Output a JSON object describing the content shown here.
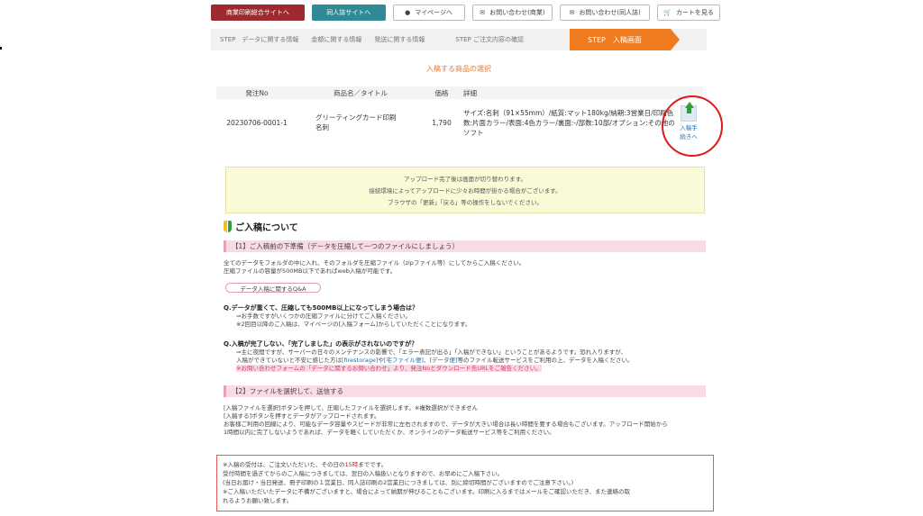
{
  "nav": {
    "btn1": "商業印刷総合サイトへ",
    "btn2": "同人誌サイトへ",
    "btn3": "マイページへ",
    "btn4": "お問い合わせ(商業)",
    "btn5": "お問い合わせ(同人誌)",
    "btn6": "カートを見る"
  },
  "steps": [
    "STEP　データに関する情報",
    "金額に関する情報",
    "発送に関する情報",
    "STEP ご注文内容の確認",
    "STEP　入稿画面"
  ],
  "select_title": "入稿する商品の選択",
  "table": {
    "headers": [
      "発注No",
      "商品名／タイトル",
      "価格",
      "詳細"
    ],
    "order_no": "20230706-0001-1",
    "name_line1": "グリーティングカード印刷",
    "name_line2": "名刺",
    "price": "1,790",
    "detail": "サイズ:名刺（91×55mm）/紙質:マット180kg/納期:3営業日/印刷色数:片面カラー/表面:4色カラー/裏面:-/部数:10部/オプション:その他のソフト"
  },
  "upload_label_1": "入稿手",
  "upload_label_2": "続きへ",
  "notice": {
    "line1": "アップロード完了後は画面が切り替わります。",
    "line2": "接続環境によってアップロードに少々お時間が掛かる場合がございます。",
    "line3": "ブラウザの「更新」「戻る」等の操作をしないでください。"
  },
  "about_title": "ご入稿について",
  "section1": {
    "heading": "【1】ご入稿前の下準備（データを圧縮して一つのファイルにしましょう）",
    "p1": "全てのデータをフォルダの中に入れ、そのフォルダを圧縮ファイル（zipファイル等）にしてからご入稿ください。",
    "p2": "圧縮ファイルの容量が500MB以下であればweb入稿が可能です。",
    "qa_button": "データ入稿に関するQ&A",
    "q1": "Q.データが重くて、圧縮しても500MB以上になってしまう場合は？",
    "a1_1": "⇒お手数ですがいくつかの圧縮ファイルに分けてご入稿ください。",
    "a1_2": "※2回目以降のご入稿は、マイページの[入稿フォーム]からしていただくことになります。",
    "q2": "Q.入稿が完了しない、「完了しました」の表示がされないのですが？",
    "a2_1": "⇒主に夜間ですが、サーバーの日々のメンテナンスの影響で、「エラー表記が出る」「入稿ができない」ということがあるようです。恐れ入りますが、",
    "a2_2a": "入稿ができていないと不安に感じた方は",
    "a2_2b": "[firestorage]",
    "a2_2c": "や",
    "a2_2d": "[宅ファイル便]",
    "a2_2e": "、",
    "a2_2f": "[データ便]",
    "a2_2g": "等のファイル転送サービスをご利用の上、データを入稿ください。",
    "a2_3": "※お問い合わせフォームの「データに関するお問い合わせ」より、発注Noとダウンロード先URLをご報告ください。"
  },
  "section2": {
    "heading": "【2】ファイルを選択して、送信する",
    "p1": "[入稿ファイルを選択]ボタンを押して、圧縮したファイルを選択します。※複数選択ができません",
    "p2": "[入稿する]ボタンを押すとデータがアップロードされます。",
    "p3": "お客様ご利用の回線により、可能なデータ容量やスピードが非常に左右されますので、データが大きい場合は長い時間を要する場合もございます。アップロード開始から",
    "p4": "1時間以内に完了しないようであれば、データを軽くしていただくか、オンラインのデータ転送サービス等をご利用ください。"
  },
  "redbox": {
    "l1a": "※入稿の受付は、ご注文いただいた、その日の",
    "l1b": "15時",
    "l1c": "までです。",
    "l2": "受付時間を過ぎてからのご入稿につきましては、翌日の入稿扱いとなりますので、お早めにご入稿下さい。",
    "l3": "(当日お届け・当日発送、冊子印刷の１営業日、同人誌印刷の2営業日につきましては、別に締切時間がございますのでご注意下さい。)",
    "l4": "※ご入稿いただいたデータに不備がございますと、場合によって納期が伸びることもございます。印刷に入るまではメールをご確認いただき、また連絡の取",
    "l5": "れるようお願い致します。"
  },
  "colors": {
    "nav_red": "#9c2a2e",
    "nav_teal": "#2f8a95",
    "step_active": "#f07a1e",
    "circle": "#e01919"
  },
  "icons": [
    "person-icon",
    "mail-icon",
    "cart-icon",
    "upload-icon",
    "beginner-mark-icon"
  ]
}
